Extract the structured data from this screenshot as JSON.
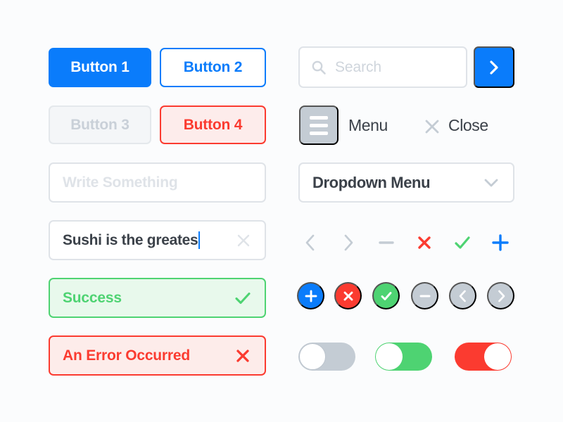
{
  "theme": {
    "background": "#fbfcfd",
    "blue": "#0a7cfb",
    "green": "#4ed372",
    "red": "#fb3b30",
    "gray": "#c4ccd4",
    "border_gray": "#dfe3e8",
    "text_dark": "#3b4149",
    "disabled_text": "#c9d0d8"
  },
  "buttons": {
    "primary": {
      "label": "Button 1"
    },
    "outline": {
      "label": "Button 2"
    },
    "disabled": {
      "label": "Button 3"
    },
    "danger": {
      "label": "Button 4"
    }
  },
  "inputs": {
    "empty": {
      "placeholder": "Write Something",
      "value": ""
    },
    "filled": {
      "value": "Sushi is the greates",
      "clear_icon": "close-icon"
    }
  },
  "alerts": {
    "success": {
      "message": "Success",
      "icon": "check-icon"
    },
    "error": {
      "message": "An Error Occurred",
      "icon": "close-icon"
    }
  },
  "search": {
    "placeholder": "Search",
    "value": "",
    "icon": "search-icon",
    "submit_icon": "chevron-right-icon"
  },
  "menu": {
    "hamburger_icon": "hamburger-icon",
    "menu_label": "Menu",
    "close_icon": "close-icon",
    "close_label": "Close"
  },
  "dropdown": {
    "selected": "Dropdown Menu",
    "caret_icon": "chevron-down-icon"
  },
  "icon_row": [
    {
      "name": "chevron-left-icon",
      "color": "#c4ccd4"
    },
    {
      "name": "chevron-right-icon",
      "color": "#c4ccd4"
    },
    {
      "name": "minus-icon",
      "color": "#c4ccd4"
    },
    {
      "name": "close-icon",
      "color": "#fb3b30"
    },
    {
      "name": "check-icon",
      "color": "#4ed372"
    },
    {
      "name": "plus-icon",
      "color": "#0a7cfb"
    }
  ],
  "circle_buttons": [
    {
      "name": "plus-circle-button",
      "icon": "plus-icon",
      "color": "#0a7cfb"
    },
    {
      "name": "close-circle-button",
      "icon": "close-icon",
      "color": "#fb3b30"
    },
    {
      "name": "check-circle-button",
      "icon": "check-icon",
      "color": "#4ed372"
    },
    {
      "name": "minus-circle-button",
      "icon": "minus-icon",
      "color": "#c4ccd4"
    },
    {
      "name": "prev-circle-button",
      "icon": "chevron-left-icon",
      "color": "#c4ccd4"
    },
    {
      "name": "next-circle-button",
      "icon": "chevron-right-icon",
      "color": "#c4ccd4"
    }
  ],
  "toggles": [
    {
      "name": "toggle-default",
      "state": "off",
      "color": "#c4ccd4"
    },
    {
      "name": "toggle-success",
      "state": "off",
      "color": "#4ed372"
    },
    {
      "name": "toggle-danger",
      "state": "on",
      "color": "#fb3b30"
    }
  ]
}
